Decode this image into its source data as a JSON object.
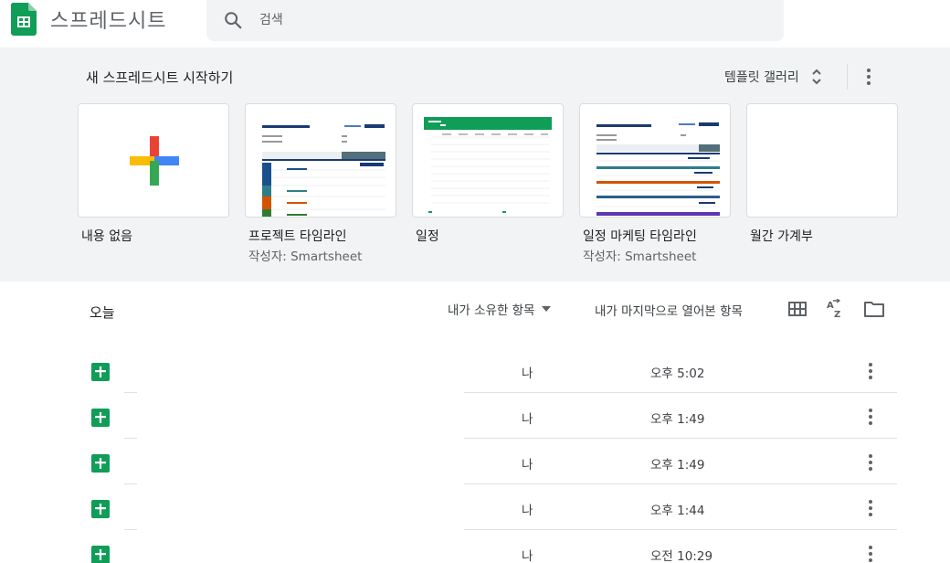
{
  "header": {
    "app_title": "스프레드시트",
    "search_placeholder": "검색"
  },
  "templates": {
    "heading": "새 스프레드시트 시작하기",
    "gallery_label": "템플릿 갤러리",
    "cards": [
      {
        "title": "내용 없음",
        "subtitle": ""
      },
      {
        "title": "프로젝트 타임라인",
        "subtitle": "작성자: Smartsheet"
      },
      {
        "title": "일정",
        "subtitle": ""
      },
      {
        "title": "일정 마케팅 타임라인",
        "subtitle": "작성자: Smartsheet"
      },
      {
        "title": "월간 가계부",
        "subtitle": ""
      }
    ]
  },
  "recent": {
    "label": "오늘",
    "owner_filter": "내가 소유한 항목",
    "sort_label": "내가 마지막으로 열어본 항목",
    "files": [
      {
        "owner": "나",
        "date": "오후 5:02"
      },
      {
        "owner": "나",
        "date": "오후 1:49"
      },
      {
        "owner": "나",
        "date": "오후 1:49"
      },
      {
        "owner": "나",
        "date": "오후 1:44"
      },
      {
        "owner": "나",
        "date": "오전 10:29"
      }
    ]
  },
  "icons": {
    "logo": "sheets-logo-icon",
    "search": "search-icon",
    "grid_view": "grid-view-icon",
    "sort": "sort-az-icon",
    "folder": "folder-icon",
    "more": "more-vert-icon"
  },
  "colors": {
    "sheets_green": "#0f9d58",
    "template_bg": "#f1f3f4",
    "text_secondary": "#5f6368"
  }
}
